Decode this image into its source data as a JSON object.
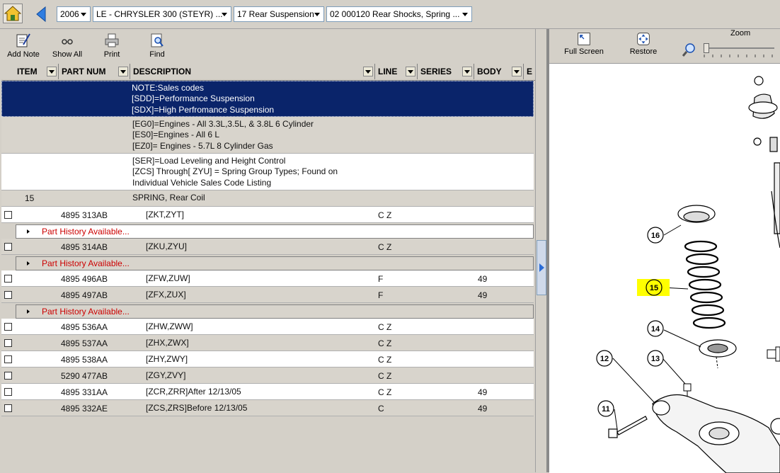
{
  "selectors": {
    "year": "2006",
    "model": "LE - CHRYSLER 300 (STEYR) ...",
    "group": "17 Rear Suspension",
    "figure": "02  000120  Rear Shocks, Spring  ..."
  },
  "toolbar": {
    "add_note": "Add Note",
    "show_all": "Show All",
    "print": "Print",
    "find": "Find"
  },
  "columns": {
    "item": "ITEM",
    "part_num": "PART NUM",
    "description": "DESCRIPTION",
    "line": "LINE",
    "series": "SERIES",
    "body": "BODY",
    "extra": "E"
  },
  "notes": {
    "n1": "NOTE:Sales codes",
    "n2": "[SDD]=Performance Suspension",
    "n3": "[SDX]=High Perfromance Suspension",
    "n4": "[EG0]=Engines - All 3.3L,3.5L, & 3.8L 6 Cylinder",
    "n5": "[ES0]=Engines - All 6 L",
    "n6": "[EZ0]= Engines - 5.7L 8 Cylinder Gas",
    "n7": "[SER]=Load Leveling and Height Control",
    "n8": "[ZCS] Through[ ZYU] = Spring Group Types; Found on",
    "n9": " Individual Vehicle Sales Code Listing"
  },
  "group_row": {
    "item": "15",
    "description": "SPRING, Rear Coil"
  },
  "part_history_label": "Part History Available...",
  "parts": [
    {
      "part": "4895 313AB",
      "desc": "[ZKT,ZYT]",
      "line": "C Z",
      "body": ""
    },
    {
      "part": "4895 314AB",
      "desc": "[ZKU,ZYU]",
      "line": "C Z",
      "body": ""
    },
    {
      "part": "4895 496AB",
      "desc": "[ZFW,ZUW]",
      "line": "F",
      "body": "49"
    },
    {
      "part": "4895 497AB",
      "desc": "[ZFX,ZUX]",
      "line": "F",
      "body": "49"
    },
    {
      "part": "4895 536AA",
      "desc": "[ZHW,ZWW]",
      "line": "C Z",
      "body": ""
    },
    {
      "part": "4895 537AA",
      "desc": "[ZHX,ZWX]",
      "line": "C Z",
      "body": ""
    },
    {
      "part": "4895 538AA",
      "desc": "[ZHY,ZWY]",
      "line": "C Z",
      "body": ""
    },
    {
      "part": "5290 477AB",
      "desc": "[ZGY,ZVY]",
      "line": "C Z",
      "body": ""
    },
    {
      "part": "4895 331AA",
      "desc": "[ZCR,ZRR]After 12/13/05",
      "line": "C Z",
      "body": "49"
    },
    {
      "part": "4895 332AE",
      "desc": "[ZCS,ZRS]Before 12/13/05",
      "line": "C",
      "body": "49"
    }
  ],
  "right_toolbar": {
    "full_screen": "Full Screen",
    "restore": "Restore",
    "zoom": "Zoom"
  },
  "callouts": [
    "16",
    "15",
    "14",
    "13",
    "12",
    "11"
  ],
  "colors": {
    "selected_row": "#0a246a",
    "history_link": "#cc0000",
    "highlight": "#ffff00"
  }
}
